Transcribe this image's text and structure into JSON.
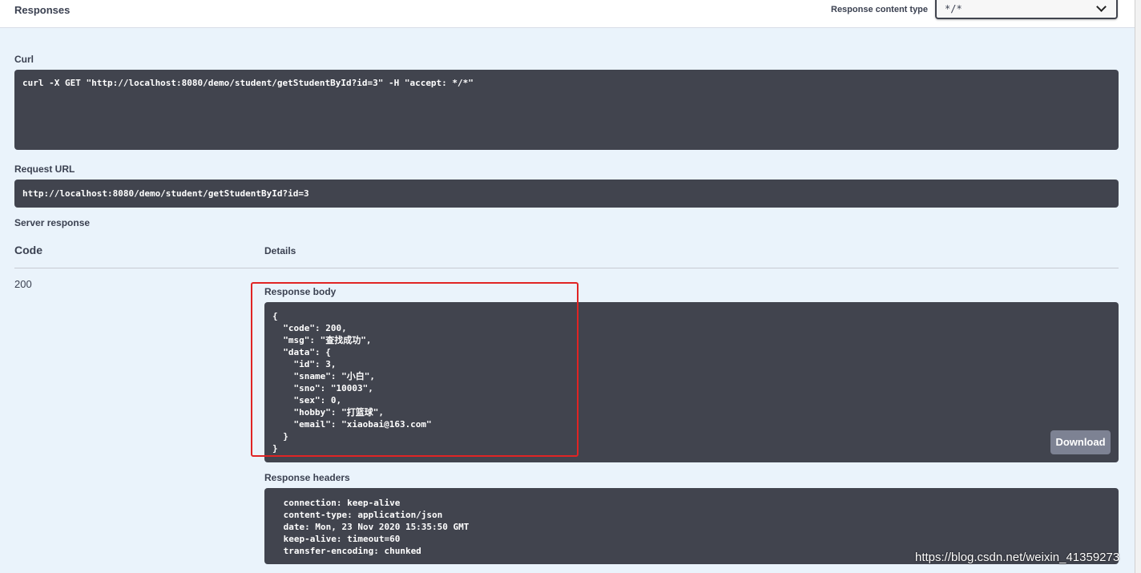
{
  "header": {
    "title": "Responses",
    "content_type_label": "Response content type",
    "content_type_value": "*/*"
  },
  "curl": {
    "label": "Curl",
    "command": "curl -X GET \"http://localhost:8080/demo/student/getStudentById?id=3\" -H \"accept: */*\""
  },
  "request_url": {
    "label": "Request URL",
    "value": "http://localhost:8080/demo/student/getStudentById?id=3"
  },
  "server_response": {
    "label": "Server response",
    "col_code": "Code",
    "col_details": "Details",
    "status_code": "200",
    "body_label": "Response body",
    "body": "{\n  \"code\": 200,\n  \"msg\": \"查找成功\",\n  \"data\": {\n    \"id\": 3,\n    \"sname\": \"小白\",\n    \"sno\": \"10003\",\n    \"sex\": 0,\n    \"hobby\": \"打篮球\",\n    \"email\": \"xiaobai@163.com\"\n  }\n}",
    "download_label": "Download",
    "headers_label": "Response headers",
    "headers": " connection: keep-alive\n content-type: application/json\n date: Mon, 23 Nov 2020 15:35:50 GMT\n keep-alive: timeout=60\n transfer-encoding: chunked"
  },
  "watermark": "https://blog.csdn.net/weixin_41359273",
  "colors": {
    "code_bg": "#41444e",
    "page_bg": "#eaf3fb",
    "highlight": "#e02424",
    "download_bg": "#7d8293"
  }
}
